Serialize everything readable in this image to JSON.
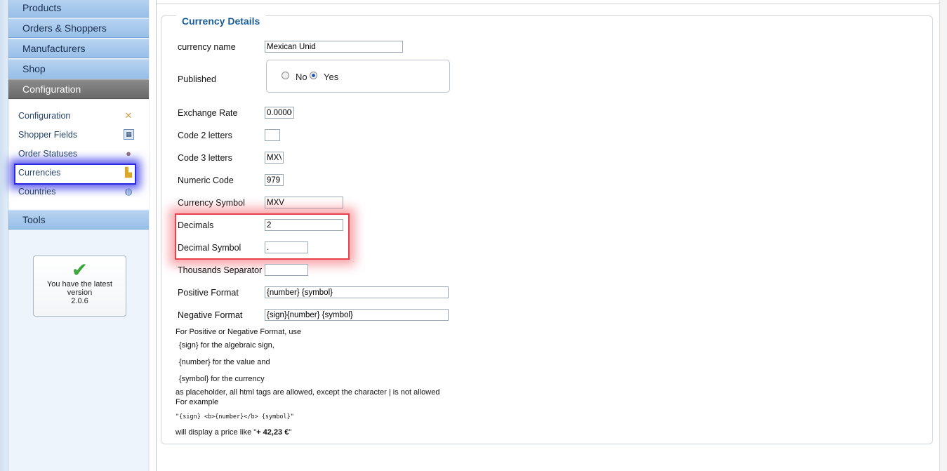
{
  "sidebar": {
    "menu": [
      {
        "label": "Products"
      },
      {
        "label": "Orders & Shoppers"
      },
      {
        "label": "Manufacturers"
      },
      {
        "label": "Shop"
      },
      {
        "label": "Configuration"
      }
    ],
    "submenu": [
      {
        "label": "Configuration",
        "icon": "tools-icon"
      },
      {
        "label": "Shopper Fields",
        "icon": "shopper-fields-icon"
      },
      {
        "label": "Order Statuses",
        "icon": "order-status-icon"
      },
      {
        "label": "Currencies",
        "icon": "coins-icon"
      },
      {
        "label": "Countries",
        "icon": "globe-icon"
      }
    ],
    "tools_label": "Tools",
    "version": {
      "line1": "You have the latest",
      "line2": "version",
      "number": "2.0.6"
    }
  },
  "form": {
    "legend": "Currency Details",
    "currency_name": {
      "label": "currency name",
      "value": "Mexican Unid"
    },
    "published": {
      "label": "Published",
      "no": "No",
      "yes": "Yes",
      "selected": "Yes"
    },
    "exchange_rate": {
      "label": "Exchange Rate",
      "value": "0.00000"
    },
    "code2": {
      "label": "Code 2 letters",
      "value": ""
    },
    "code3": {
      "label": "Code 3 letters",
      "value": "MXV"
    },
    "numeric_code": {
      "label": "Numeric Code",
      "value": "979"
    },
    "currency_symbol": {
      "label": "Currency Symbol",
      "value": "MXV"
    },
    "decimals": {
      "label": "Decimals",
      "value": "2"
    },
    "decimal_symbol": {
      "label": "Decimal Symbol",
      "value": "."
    },
    "thousands_separator": {
      "label": "Thousands Separator",
      "value": ""
    },
    "positive_format": {
      "label": "Positive Format",
      "value": "{number} {symbol}"
    },
    "negative_format": {
      "label": "Negative Format",
      "value": "{sign}{number} {symbol}"
    }
  },
  "help": {
    "intro": "For Positive or Negative Format, use",
    "sign": "{sign} for the algebraic sign,",
    "number": "{number} for the value and",
    "symbol": "{symbol} for the currency",
    "placeholder_note": "as placeholder, all html tags are allowed, except the character | is not allowed",
    "example_label": "For example",
    "example_code": "\"{sign} <b>{number}</b> {symbol}\"",
    "display_prefix": "will display a price like \"",
    "display_value": "+ 42,23 €",
    "display_suffix": "\""
  },
  "colors": {
    "legend": "#1b5e9c",
    "menu_active": "#6a6a6a",
    "menu_bg": "#98bfe8",
    "blue_highlight": "#2a28e0",
    "red_highlight": "#e8414a"
  }
}
